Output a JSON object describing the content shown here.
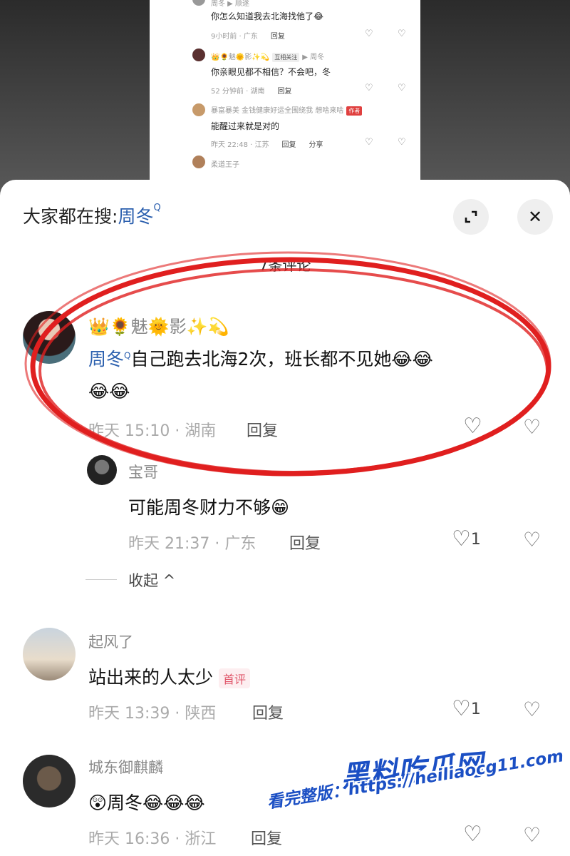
{
  "mini": {
    "c1": {
      "name": "周冬 ▶ 顺遂",
      "text": "你怎么知道我去北海找他了😂",
      "time": "9小时前 · 广东",
      "reply": "回复"
    },
    "c2": {
      "name": "👑🌻魅🌞影✨💫",
      "mutual": "互相关注",
      "target": "▶ 周冬",
      "text": "你亲眼见都不相信？不会吧，冬",
      "time": "52 分钟前 · 湖南",
      "reply": "回复"
    },
    "c3": {
      "name": "暴富暴美 金钱健康好运全围绕我 想啥来啥",
      "author": "作者",
      "text": "能醒过来就是对的",
      "time": "昨天 22:48 · 江苏",
      "reply": "回复",
      "share": "分享"
    },
    "c4": {
      "name": "柔道王子"
    }
  },
  "header": {
    "search_prefix": "大家都在搜:",
    "search_keyword": "周冬",
    "search_icon": "Q",
    "expand_icon": "⌞⌝",
    "close_icon": "✕"
  },
  "comment_count": "7条评论",
  "comments": [
    {
      "name": "👑🌻魅🌞影✨💫",
      "mention": "周冬",
      "mention_icon": "Q",
      "text": "自己跑去北海2次，班长都不见她😂😂",
      "text2": "😂😂",
      "time": "昨天 15:10 · 湖南",
      "reply": "回复",
      "likes": ""
    },
    {
      "name": "宝哥",
      "text": "可能周冬财力不够😁",
      "time": "昨天 21:37 · 广东",
      "reply": "回复",
      "likes": "1"
    },
    {
      "name": "起风了",
      "text": "站出来的人太少",
      "badge": "首评",
      "time": "昨天 13:39 · 陕西",
      "reply": "回复",
      "likes": "1"
    },
    {
      "name": "城东御麒麟",
      "text": "😲周冬😂😂😂",
      "time": "昨天 16:36 · 浙江",
      "reply": "回复",
      "likes": ""
    }
  ],
  "collapse_label": "收起 ^",
  "watermark": {
    "line1": "黑料吃瓜网",
    "line2": "看完整版：https://heiliaocg11.com"
  },
  "colors": {
    "accent": "#2b5fae",
    "annotation": "#e01f1f",
    "first_badge": "#e0566a",
    "watermark": "#1b4fc4"
  }
}
